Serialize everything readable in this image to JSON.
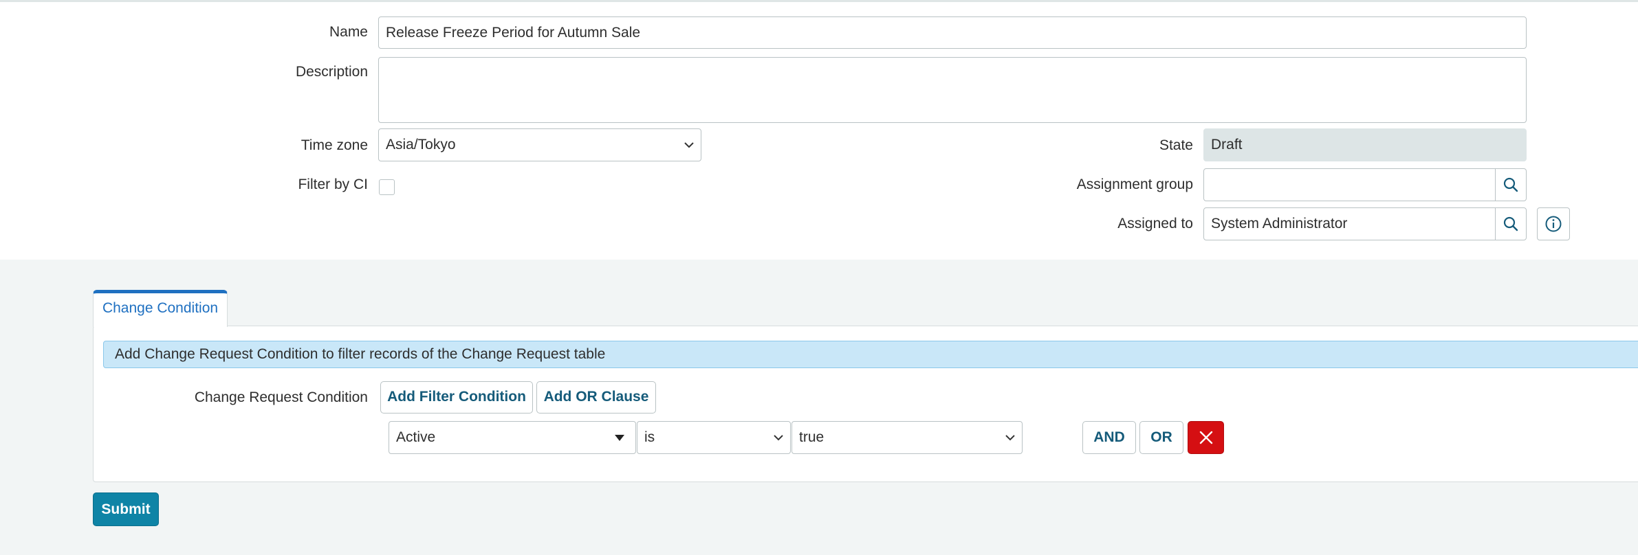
{
  "form": {
    "name_label": "Name",
    "name_value": "Release Freeze Period for Autumn Sale",
    "description_label": "Description",
    "description_value": "",
    "timezone_label": "Time zone",
    "timezone_value": "Asia/Tokyo",
    "filter_ci_label": "Filter by CI",
    "filter_ci_checked": false,
    "state_label": "State",
    "state_value": "Draft",
    "assignment_group_label": "Assignment group",
    "assignment_group_value": "",
    "assigned_to_label": "Assigned to",
    "assigned_to_value": "System Administrator"
  },
  "tabs": [
    {
      "label": "Change Condition",
      "active": true
    }
  ],
  "condition_panel": {
    "info_text": "Add Change Request Condition to filter records of the Change Request table",
    "condition_label": "Change Request Condition",
    "add_filter_label": "Add Filter Condition",
    "add_or_label": "Add OR Clause",
    "row": {
      "field": "Active",
      "operator": "is",
      "value": "true",
      "and_label": "AND",
      "or_label": "OR"
    }
  },
  "submit_label": "Submit",
  "icons": {
    "lookup": "search-icon",
    "info": "info-icon",
    "delete": "close-icon",
    "dropdown": "chevron-down-icon"
  },
  "colors": {
    "accent": "#1f70c1",
    "link": "#155b7a",
    "submit": "#0f84a6",
    "delete": "#d50f12",
    "info_bar": "#c9e7f8",
    "readonly": "#dde5e6"
  }
}
